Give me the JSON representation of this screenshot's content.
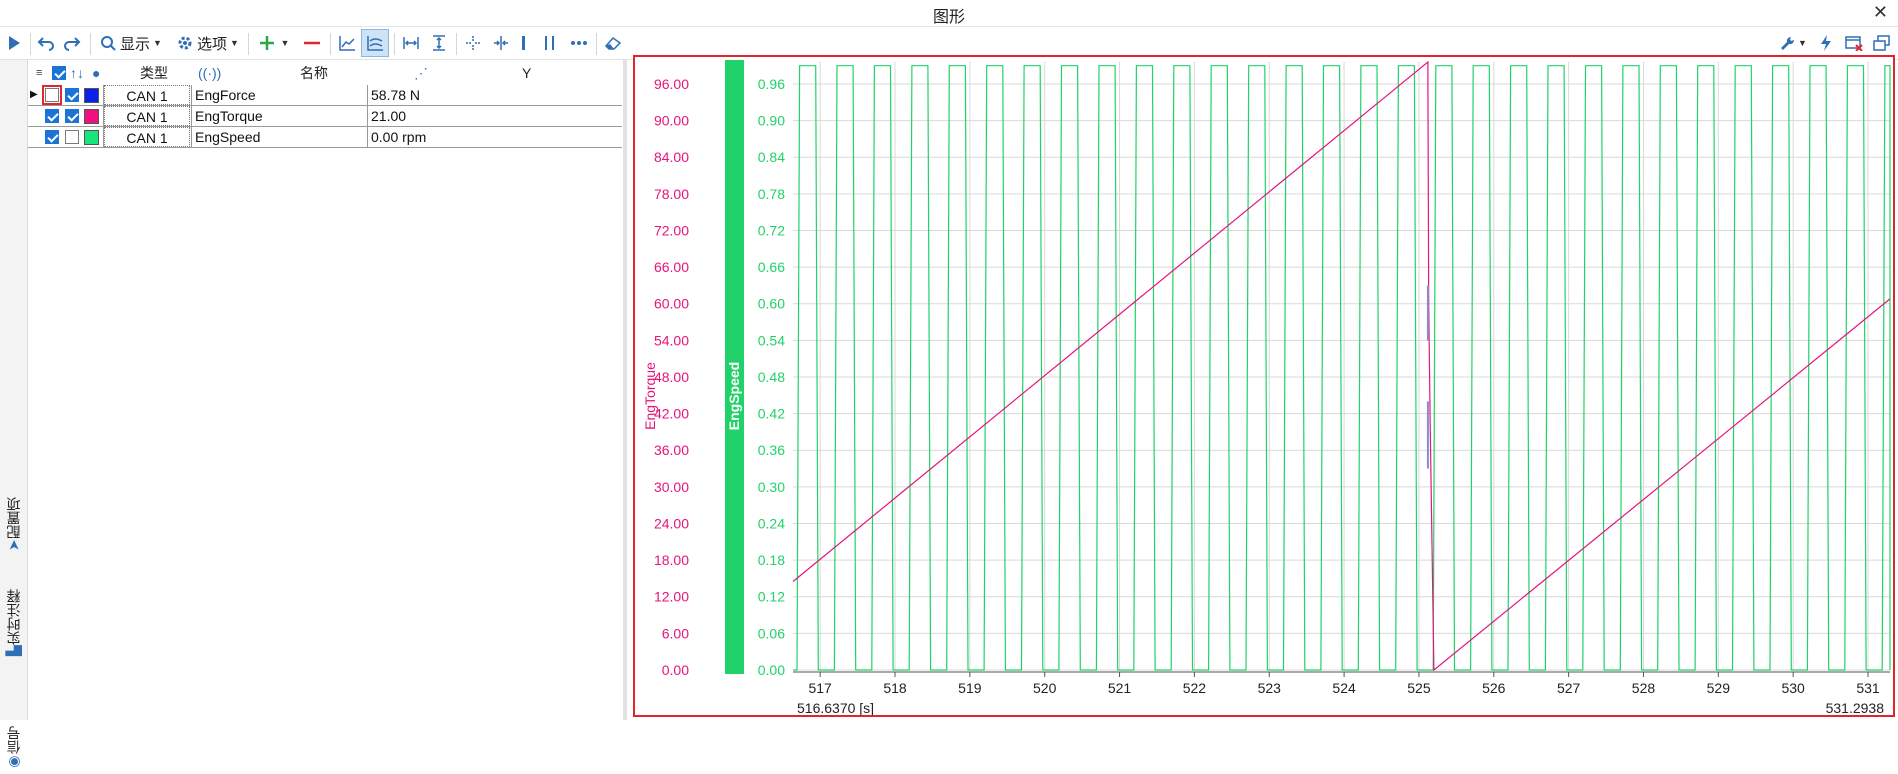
{
  "window": {
    "title": "图形",
    "close_glyph": "✕"
  },
  "toolbar": {
    "display_label": "显示",
    "options_label": "选项"
  },
  "sidebar": {
    "tabs": [
      {
        "label": "配置项",
        "icon": "pin-icon"
      },
      {
        "label": "实时注释",
        "icon": "note-icon"
      },
      {
        "label": "信号",
        "icon": "signal-icon"
      }
    ]
  },
  "signal_table": {
    "headers": {
      "type": "类型",
      "name": "名称",
      "y": "Y"
    },
    "rows": [
      {
        "visible": false,
        "axis": true,
        "color": "#0a1fe8",
        "type": "CAN 1",
        "name": "EngForce",
        "value": "58.78 N"
      },
      {
        "visible": true,
        "axis": true,
        "color": "#f0107f",
        "type": "CAN 1",
        "name": "EngTorque",
        "value": "21.00"
      },
      {
        "visible": true,
        "axis": false,
        "color": "#18e67c",
        "type": "CAN 1",
        "name": "EngSpeed",
        "value": "0.00 rpm"
      }
    ]
  },
  "chart_data": {
    "type": "line",
    "y_left": {
      "label": "EngTorque",
      "color": "#e8137d",
      "range": [
        0,
        99.6
      ],
      "ticks": [
        "96.00",
        "90.00",
        "84.00",
        "78.00",
        "72.00",
        "66.00",
        "60.00",
        "54.00",
        "48.00",
        "42.00",
        "36.00",
        "30.00",
        "24.00",
        "18.00",
        "12.00",
        "6.00",
        "0.00"
      ]
    },
    "y_right": {
      "label": "EngSpeed",
      "color": "#21d26a",
      "range": [
        0,
        0.996
      ],
      "ticks": [
        "0.96",
        "0.90",
        "0.84",
        "0.78",
        "0.72",
        "0.66",
        "0.60",
        "0.54",
        "0.48",
        "0.42",
        "0.36",
        "0.30",
        "0.24",
        "0.18",
        "0.12",
        "0.06",
        "0.00"
      ]
    },
    "x_axis": {
      "range": [
        516.637,
        531.2938
      ],
      "ticks": [
        "517",
        "518",
        "519",
        "520",
        "521",
        "522",
        "523",
        "524",
        "525",
        "526",
        "527",
        "528",
        "529",
        "530",
        "531"
      ],
      "start_label": "516.6370 [s]",
      "end_label": "531.2938"
    },
    "series": [
      {
        "name": "EngTorque",
        "color": "#e8137d",
        "points": [
          [
            516.637,
            14.5
          ],
          [
            525.12,
            99.6
          ],
          [
            525.12,
            97
          ],
          [
            525.13,
            60
          ],
          [
            525.15,
            40
          ],
          [
            525.2,
            0
          ],
          [
            531.2938,
            60.8
          ]
        ]
      },
      {
        "name": "EngSpeed",
        "color": "#21d26a",
        "square_wave": {
          "low": 0.0,
          "high": 0.99,
          "period_s": 0.5,
          "duty": 0.5,
          "phase_s": 516.69
        }
      }
    ],
    "grid": true,
    "legend": "none"
  }
}
